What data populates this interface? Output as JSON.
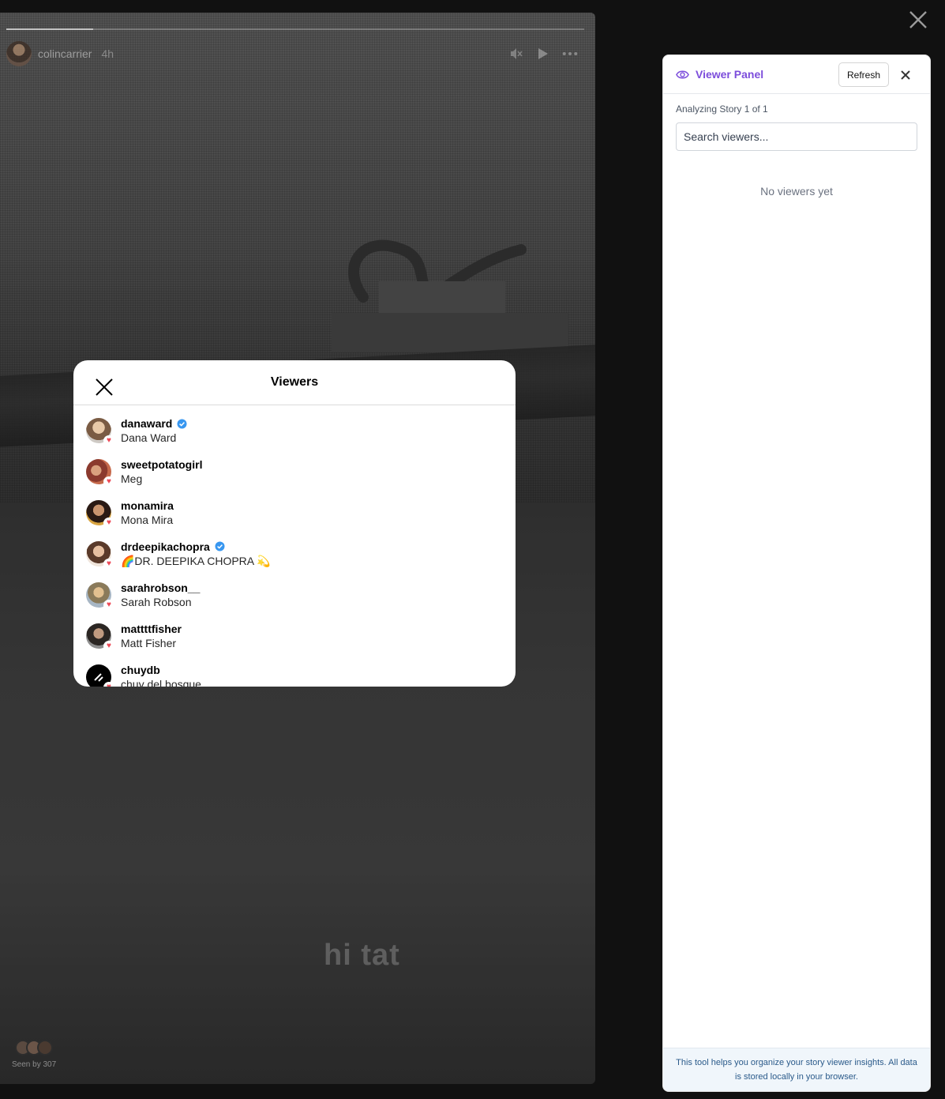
{
  "story": {
    "username": "colincarrier",
    "time_ago": "4h",
    "caption": "hi tat",
    "seen_by": "Seen by 307",
    "progress": 0.15
  },
  "viewers_modal": {
    "title": "Viewers",
    "viewers": [
      {
        "username": "danaward",
        "full_name": "Dana Ward",
        "verified": true,
        "liked": true
      },
      {
        "username": "sweetpotatogirl",
        "full_name": "Meg",
        "verified": false,
        "liked": true
      },
      {
        "username": "monamira",
        "full_name": "Mona Mira",
        "verified": false,
        "liked": true
      },
      {
        "username": "drdeepikachopra",
        "full_name": "🌈DR. DEEPIKA CHOPRA 💫",
        "verified": true,
        "liked": true
      },
      {
        "username": "sarahrobson__",
        "full_name": "Sarah Robson",
        "verified": false,
        "liked": true
      },
      {
        "username": "mattttfisher",
        "full_name": "Matt Fisher",
        "verified": false,
        "liked": true
      },
      {
        "username": "chuydb",
        "full_name": "chuy del bosque",
        "verified": false,
        "liked": true
      }
    ]
  },
  "panel": {
    "title": "Viewer Panel",
    "refresh_label": "Refresh",
    "status": "Analyzing Story 1 of 1",
    "search_placeholder": "Search viewers...",
    "empty_message": "No viewers yet",
    "footer": "This tool helps you organize your story viewer insights. All data is stored locally in your browser."
  },
  "colors": {
    "accent": "#7c4ddb",
    "heart": "#ed4956",
    "verified": "#3897f0"
  }
}
